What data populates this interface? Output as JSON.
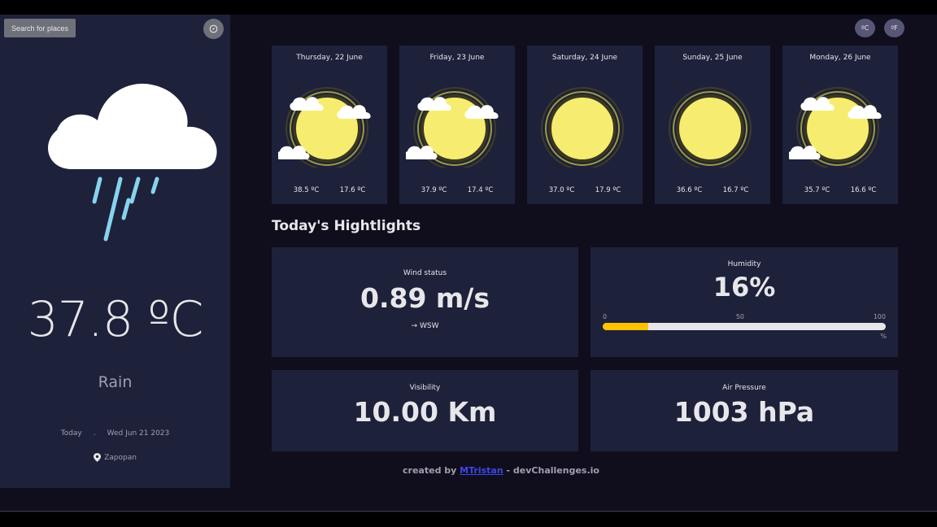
{
  "sidebar": {
    "search_label": "Search for places",
    "icon": "crosshair-icon",
    "weather_icon": "heavy-rain-icon",
    "temperature": "37.8 ºC",
    "condition": "Rain",
    "today_label": "Today",
    "separator": ".",
    "date": "Wed Jun 21 2023",
    "location_icon": "map-pin-icon",
    "location": "Zapopan"
  },
  "units": {
    "celsius": "ºC",
    "fahrenheit": "ºF"
  },
  "forecast": [
    {
      "date": "Thursday, 22 June",
      "max": "38.5 ºC",
      "min": "17.6 ºC",
      "icon": "sun-with-clouds-icon"
    },
    {
      "date": "Friday, 23 June",
      "max": "37.9 ºC",
      "min": "17.4 ºC",
      "icon": "sun-with-clouds-icon"
    },
    {
      "date": "Saturday, 24 June",
      "max": "37.0 ºC",
      "min": "17.9 ºC",
      "icon": "sun-icon"
    },
    {
      "date": "Sunday, 25 June",
      "max": "36.6 ºC",
      "min": "16.7 ºC",
      "icon": "sun-icon"
    },
    {
      "date": "Monday, 26 June",
      "max": "35.7 ºC",
      "min": "16.6 ºC",
      "icon": "sun-with-clouds-icon"
    }
  ],
  "highlights": {
    "title": "Today's Hightlights",
    "wind": {
      "label": "Wind status",
      "value": "0.89 m/s",
      "direction_icon": "arrow-right-icon",
      "direction": "WSW"
    },
    "humidity": {
      "label": "Humidity",
      "value": "16%",
      "scale_min": "0",
      "scale_mid": "50",
      "scale_max": "100",
      "unit": "%",
      "percent": 16
    },
    "visibility": {
      "label": "Visibility",
      "value": "10.00 Km"
    },
    "pressure": {
      "label": "Air Pressure",
      "value": "1003 hPa"
    }
  },
  "footer": {
    "prefix": "created by",
    "author": "MTristan",
    "suffix": "- devChallenges.io"
  },
  "colors": {
    "background": "#100e1d",
    "panel": "#1e213a",
    "sun": "#f6ed70",
    "humidity_fill": "#ffc300",
    "link": "#3c47e9"
  }
}
